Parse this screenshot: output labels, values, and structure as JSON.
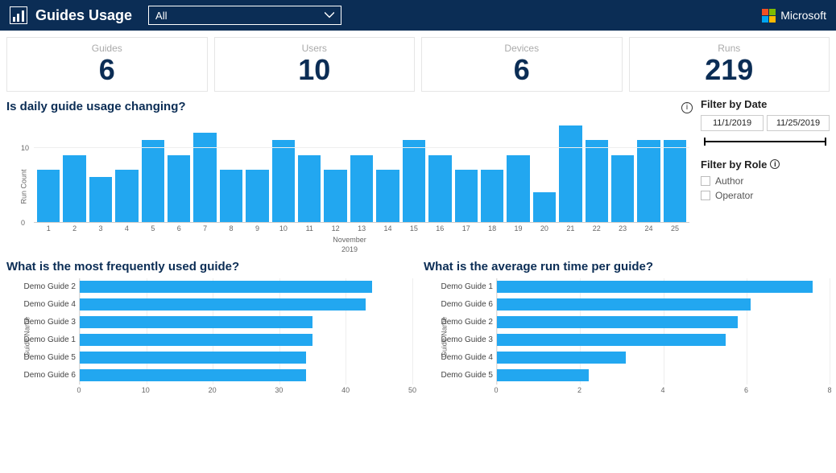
{
  "header": {
    "title": "Guides Usage",
    "dropdown_value": "All",
    "brand": "Microsoft"
  },
  "kpis": [
    {
      "label": "Guides",
      "value": "6"
    },
    {
      "label": "Users",
      "value": "10"
    },
    {
      "label": "Devices",
      "value": "6"
    },
    {
      "label": "Runs",
      "value": "219"
    }
  ],
  "daily": {
    "title": "Is daily guide usage changing?",
    "ylabel": "Run Count",
    "month_label": "November",
    "year_label": "2019"
  },
  "filters": {
    "date_title": "Filter by Date",
    "date_from": "11/1/2019",
    "date_to": "11/25/2019",
    "role_title": "Filter by Role",
    "role_author": "Author",
    "role_operator": "Operator"
  },
  "freq": {
    "title": "What is the most frequently used guide?",
    "ylabel": "Guide Name"
  },
  "avg": {
    "title": "What is the average run time per guide?",
    "ylabel": "Guide Name"
  },
  "chart_data": [
    {
      "type": "bar",
      "title": "Is daily guide usage changing?",
      "xlabel": "November 2019",
      "ylabel": "Run Count",
      "ylim": [
        0,
        14
      ],
      "yticks": [
        0,
        10
      ],
      "categories": [
        "1",
        "2",
        "3",
        "4",
        "5",
        "6",
        "7",
        "8",
        "9",
        "10",
        "11",
        "12",
        "13",
        "14",
        "15",
        "16",
        "17",
        "18",
        "19",
        "20",
        "21",
        "22",
        "23",
        "24",
        "25"
      ],
      "values": [
        7,
        9,
        6,
        7,
        11,
        9,
        12,
        7,
        7,
        11,
        9,
        7,
        9,
        7,
        11,
        9,
        7,
        7,
        9,
        4,
        13,
        11,
        9,
        11,
        11
      ]
    },
    {
      "type": "bar",
      "orientation": "horizontal",
      "title": "What is the most frequently used guide?",
      "ylabel": "Guide Name",
      "xlim": [
        0,
        50
      ],
      "xticks": [
        0,
        10,
        20,
        30,
        40,
        50
      ],
      "categories": [
        "Demo Guide 2",
        "Demo Guide 4",
        "Demo Guide 3",
        "Demo Guide 1",
        "Demo Guide 5",
        "Demo Guide 6"
      ],
      "values": [
        44,
        43,
        35,
        35,
        34,
        34
      ]
    },
    {
      "type": "bar",
      "orientation": "horizontal",
      "title": "What is the average run time per guide?",
      "ylabel": "Guide Name",
      "xlim": [
        0,
        8
      ],
      "xticks": [
        0,
        2,
        4,
        6,
        8
      ],
      "categories": [
        "Demo Guide 1",
        "Demo Guide 6",
        "Demo Guide 2",
        "Demo Guide 3",
        "Demo Guide 4",
        "Demo Guide 5"
      ],
      "values": [
        7.6,
        6.1,
        5.8,
        5.5,
        3.1,
        2.2
      ]
    }
  ]
}
